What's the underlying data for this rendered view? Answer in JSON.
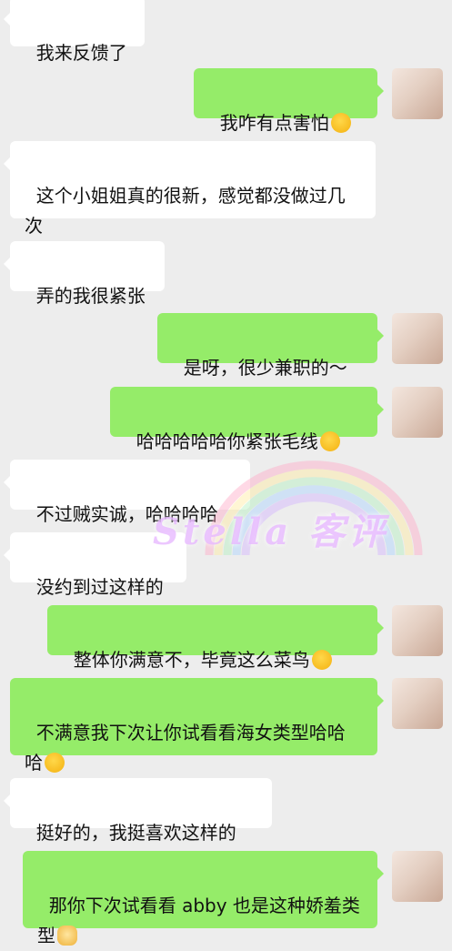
{
  "messages": [
    {
      "side": "in",
      "text": "我来反馈了"
    },
    {
      "side": "out",
      "text": "我咋有点害怕",
      "emoji": "laugh-cry-emoji"
    },
    {
      "side": "in",
      "text": "这个小姐姐真的很新，感觉都没做过几次"
    },
    {
      "side": "in",
      "text": "弄的我很紧张"
    },
    {
      "side": "out",
      "text": "是呀，很少兼职的～"
    },
    {
      "side": "out",
      "text": "哈哈哈哈哈你紧张毛线",
      "emoji": "laugh-tears-emoji"
    },
    {
      "side": "in",
      "text": "不过贼实诚，哈哈哈哈"
    },
    {
      "side": "in",
      "text": "没约到过这样的"
    },
    {
      "side": "out",
      "text": "整体你满意不，毕竟这么菜鸟",
      "emoji": "laugh-cry-emoji"
    },
    {
      "side": "out",
      "text": "不满意我下次让你试看看海女类型哈哈哈",
      "emoji": "laugh-tears-emoji"
    },
    {
      "side": "in",
      "text": "挺好的，我挺喜欢这样的"
    },
    {
      "side": "out",
      "text": "那你下次试看看 abby 也是这种娇羞类型",
      "emoji": "cat-emoji"
    }
  ],
  "watermark": {
    "text": "Stella 客评"
  },
  "colors": {
    "background": "#ededed",
    "incoming": "#ffffff",
    "outgoing": "#95ec69"
  }
}
